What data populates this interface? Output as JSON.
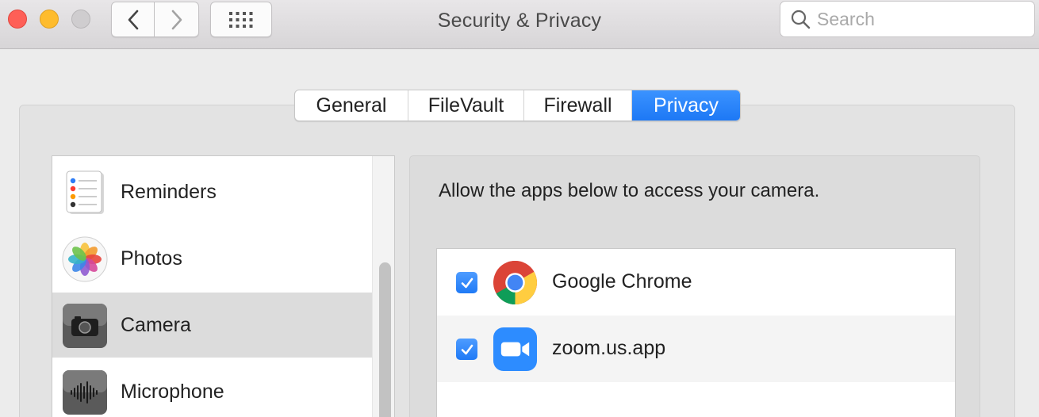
{
  "window": {
    "title": "Security & Privacy"
  },
  "search": {
    "placeholder": "Search",
    "value": ""
  },
  "tabs": [
    {
      "label": "General",
      "selected": false
    },
    {
      "label": "FileVault",
      "selected": false
    },
    {
      "label": "Firewall",
      "selected": false
    },
    {
      "label": "Privacy",
      "selected": true
    }
  ],
  "sidebar": {
    "items": [
      {
        "label": "Reminders",
        "icon": "reminders-icon",
        "selected": false
      },
      {
        "label": "Photos",
        "icon": "photos-icon",
        "selected": false
      },
      {
        "label": "Camera",
        "icon": "camera-icon",
        "selected": true
      },
      {
        "label": "Microphone",
        "icon": "microphone-icon",
        "selected": false
      }
    ]
  },
  "main": {
    "description": "Allow the apps below to access your camera.",
    "apps": [
      {
        "name": "Google Chrome",
        "icon": "chrome-icon",
        "checked": true
      },
      {
        "name": "zoom.us.app",
        "icon": "zoom-icon",
        "checked": true
      }
    ]
  },
  "colors": {
    "accent": "#1f7af6",
    "close": "#fe5f57",
    "minimize": "#febc2e"
  }
}
